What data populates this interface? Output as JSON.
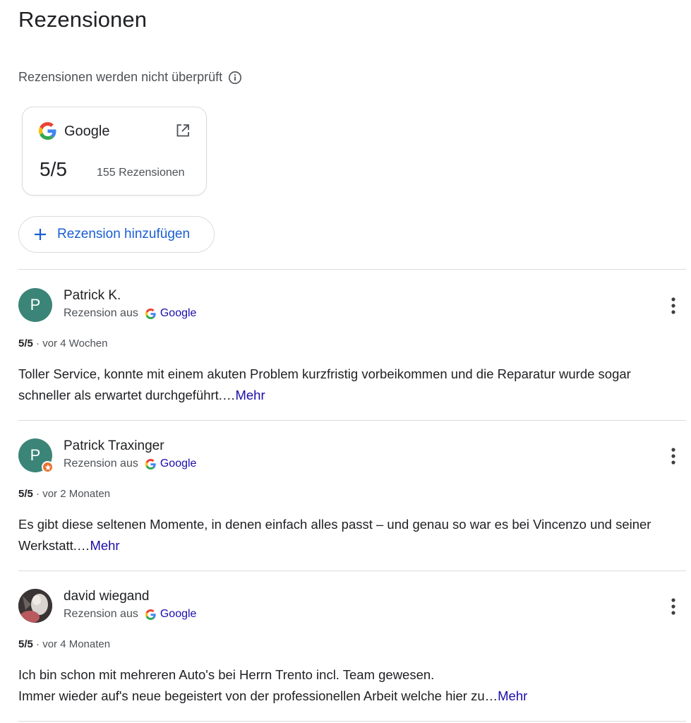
{
  "title": "Rezensionen",
  "notice": "Rezensionen werden nicht überprüft",
  "source_card": {
    "name": "Google",
    "rating": "5/5",
    "count": "155 Rezensionen"
  },
  "add_review_label": "Rezension hinzufügen",
  "reviews": [
    {
      "initial": "P",
      "name": "Patrick K.",
      "source_prefix": "Rezension aus",
      "source_name": "Google",
      "score": "5/5",
      "separator": " · ",
      "time": "vor 4 Wochen",
      "text": "Toller Service, konnte mit einem akuten Problem kurzfristig vorbeikommen und die Reparatur wurde sogar schneller als erwartet durchgeführt.…",
      "more": "Mehr"
    },
    {
      "initial": "P",
      "name": "Patrick Traxinger",
      "source_prefix": "Rezension aus",
      "source_name": "Google",
      "score": "5/5",
      "separator": " · ",
      "time": "vor 2 Monaten",
      "text": "Es gibt diese seltenen Momente, in denen einfach alles passt – und genau so war es bei Vincenzo und seiner Werkstatt.…",
      "more": "Mehr"
    },
    {
      "initial": "",
      "name": "david wiegand",
      "source_prefix": "Rezension aus",
      "source_name": "Google",
      "score": "5/5",
      "separator": " · ",
      "time": "vor 4 Monaten",
      "text": "Ich bin schon mit mehreren Auto's bei Herrn Trento incl. Team gewesen.\nImmer wieder auf's neue begeistert von der professionellen Arbeit welche hier zu…",
      "more": "Mehr"
    }
  ],
  "colors": {
    "accent": "#1a5fd1",
    "link": "#1a0dab",
    "avatar": "#3b8478",
    "local_guide_badge": "#e8712f"
  }
}
